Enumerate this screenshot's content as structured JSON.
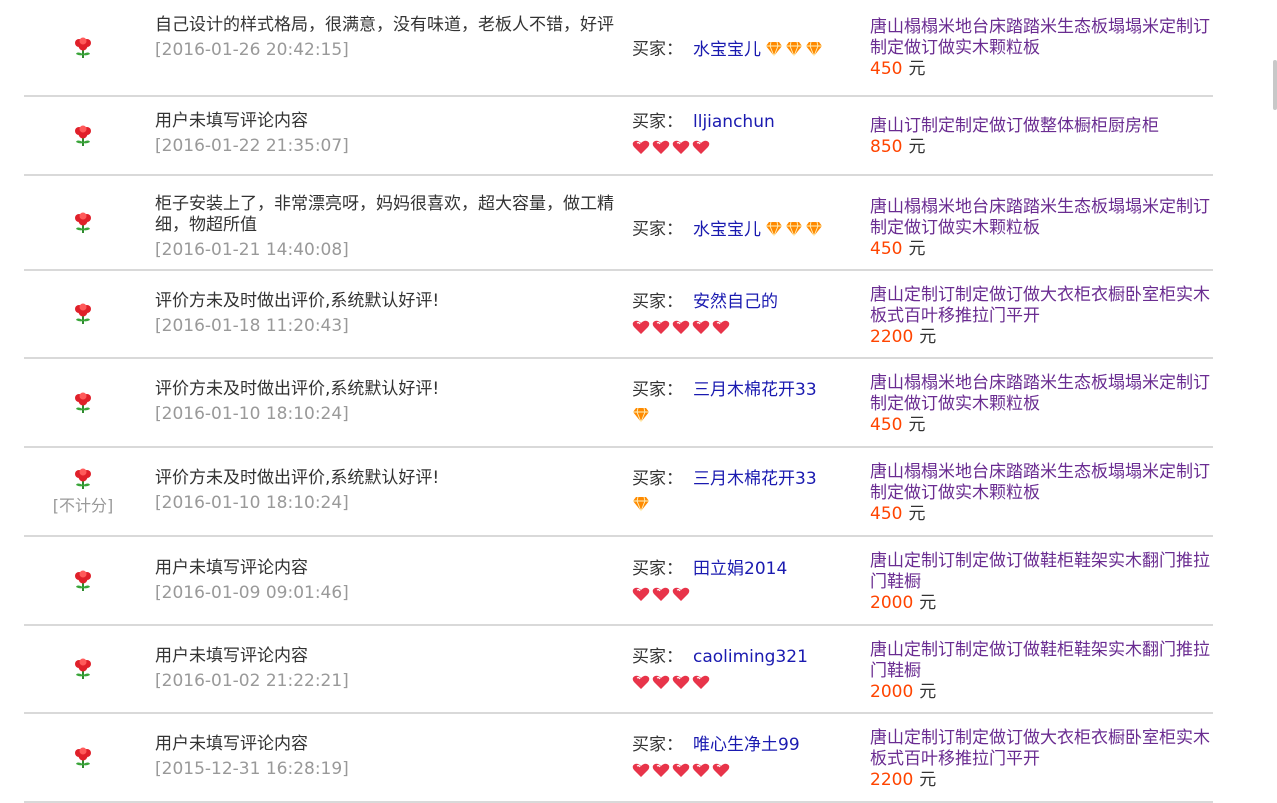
{
  "buyer_label": "买家：",
  "no_count_label": "[不计分]",
  "currency_unit": "元",
  "colors": {
    "flower": "#e0202a",
    "buyer": "#1a1ab0",
    "item": "#6a2c91",
    "price": "#ff4400"
  },
  "rows": [
    {
      "comment": "自己设计的样式格局，很满意，没有味道，老板人不错，好评",
      "date": "[2016-01-26 20:42:15]",
      "buyer": "水宝宝儿",
      "badge": "diamond-icon",
      "badge_count": 3,
      "badge_inline": true,
      "item": "唐山榻榻米地台床踏踏米生态板塌塌米定制订制定做订做实木颗粒板",
      "price": "450",
      "no_count": false
    },
    {
      "comment": "用户未填写评论内容",
      "date": "[2016-01-22 21:35:07]",
      "buyer": "lljianchun",
      "badge": "heart-icon",
      "badge_count": 4,
      "badge_inline": false,
      "item": "唐山订制定制定做订做整体橱柜厨房柜",
      "price": "850",
      "no_count": false
    },
    {
      "comment": "柜子安装上了，非常漂亮呀，妈妈很喜欢，超大容量，做工精细，物超所值",
      "date": "[2016-01-21 14:40:08]",
      "buyer": "水宝宝儿",
      "badge": "diamond-icon",
      "badge_count": 3,
      "badge_inline": true,
      "item": "唐山榻榻米地台床踏踏米生态板塌塌米定制订制定做订做实木颗粒板",
      "price": "450",
      "no_count": false
    },
    {
      "comment": "评价方未及时做出评价,系统默认好评!",
      "date": "[2016-01-18 11:20:43]",
      "buyer": "安然自己的",
      "badge": "heart-icon",
      "badge_count": 5,
      "badge_inline": false,
      "item": "唐山定制订制定做订做大衣柜衣橱卧室柜实木板式百叶移推拉门平开",
      "price": "2200",
      "no_count": false
    },
    {
      "comment": "评价方未及时做出评价,系统默认好评!",
      "date": "[2016-01-10 18:10:24]",
      "buyer": "三月木棉花开33",
      "badge": "diamond-icon",
      "badge_count": 1,
      "badge_inline": false,
      "item": "唐山榻榻米地台床踏踏米生态板塌塌米定制订制定做订做实木颗粒板",
      "price": "450",
      "no_count": false
    },
    {
      "comment": "评价方未及时做出评价,系统默认好评!",
      "date": "[2016-01-10 18:10:24]",
      "buyer": "三月木棉花开33",
      "badge": "diamond-icon",
      "badge_count": 1,
      "badge_inline": false,
      "item": "唐山榻榻米地台床踏踏米生态板塌塌米定制订制定做订做实木颗粒板",
      "price": "450",
      "no_count": true
    },
    {
      "comment": "用户未填写评论内容",
      "date": "[2016-01-09 09:01:46]",
      "buyer": "田立娟2014",
      "badge": "heart-icon",
      "badge_count": 3,
      "badge_inline": false,
      "item": "唐山定制订制定做订做鞋柜鞋架实木翻门推拉门鞋橱",
      "price": "2000",
      "no_count": false
    },
    {
      "comment": "用户未填写评论内容",
      "date": "[2016-01-02 21:22:21]",
      "buyer": "caoliming321",
      "badge": "heart-icon",
      "badge_count": 4,
      "badge_inline": false,
      "item": "唐山定制订制定做订做鞋柜鞋架实木翻门推拉门鞋橱",
      "price": "2000",
      "no_count": false
    },
    {
      "comment": "用户未填写评论内容",
      "date": "[2015-12-31 16:28:19]",
      "buyer": "唯心生净土99",
      "badge": "heart-icon",
      "badge_count": 5,
      "badge_inline": false,
      "item": "唐山定制订制定做订做大衣柜衣橱卧室柜实木板式百叶移推拉门平开",
      "price": "2200",
      "no_count": false
    }
  ]
}
